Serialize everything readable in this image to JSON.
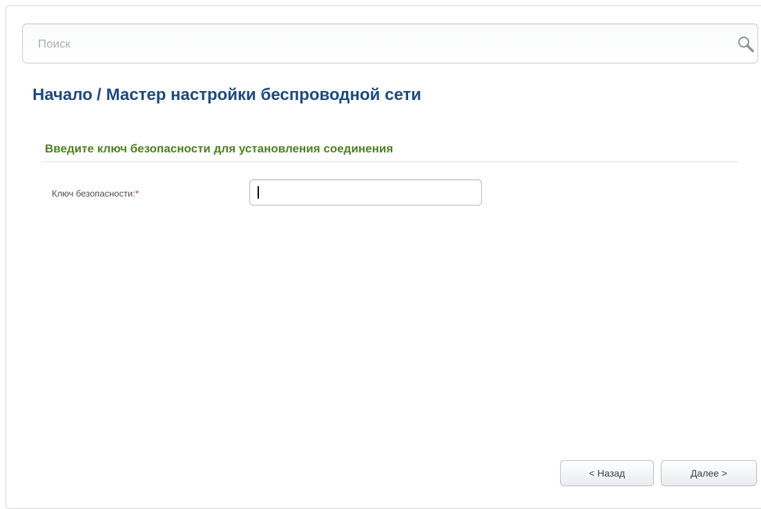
{
  "search": {
    "placeholder": "Поиск",
    "icon": "search-icon"
  },
  "breadcrumb": {
    "home": "Начало",
    "separator": "/",
    "current": "Мастер настройки беспроводной сети"
  },
  "section": {
    "title": "Введите ключ безопасности для установления соединения"
  },
  "form": {
    "security_key_label": "Ключ безопасности:",
    "required_mark": "*",
    "security_key_value": ""
  },
  "buttons": {
    "back_label": "< Назад",
    "next_label": "Далее >"
  },
  "colors": {
    "title": "#1b4a80",
    "section_title": "#4d8220",
    "required": "#d2231f"
  }
}
